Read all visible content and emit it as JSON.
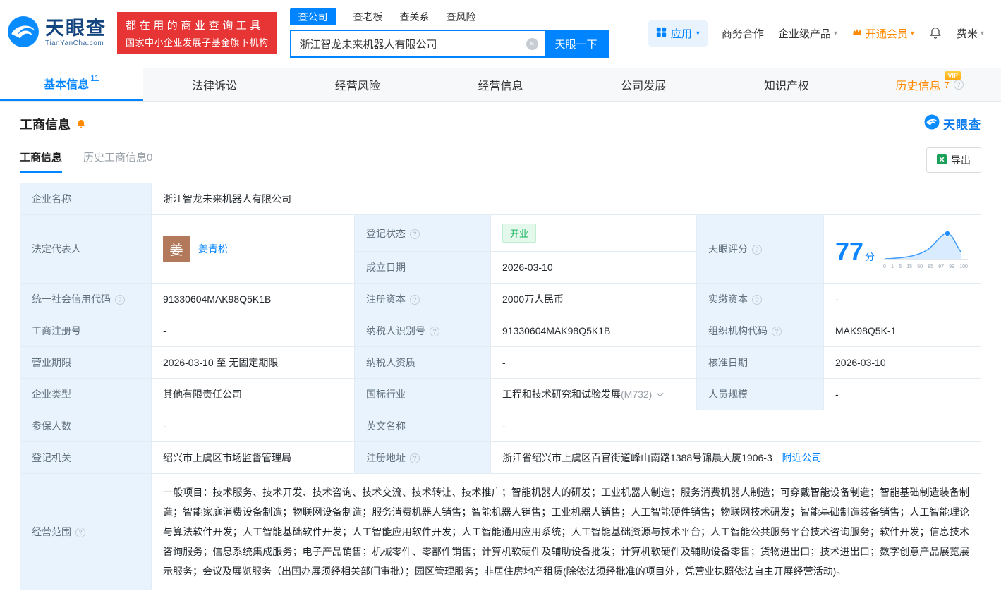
{
  "icons": {
    "help": "?",
    "caret": "▾",
    "close": "×"
  },
  "brand": {
    "logo_title": "天眼查",
    "logo_subtitle": "TianYanCha.com",
    "promo_line1": "都在用的商业查询工具",
    "promo_line2": "国家中小企业发展子基金旗下机构"
  },
  "search": {
    "tabs": [
      {
        "label": "查公司"
      },
      {
        "label": "查老板"
      },
      {
        "label": "查关系"
      },
      {
        "label": "查风险"
      }
    ],
    "value": "浙江智龙未来机器人有限公司",
    "button": "天眼一下"
  },
  "top_menu": {
    "apps": "应用",
    "cooperation": "商务合作",
    "enterprise": "企业级产品",
    "vip": "开通会员",
    "user": "费米"
  },
  "nav_tabs": [
    {
      "label": "基本信息",
      "count": "11"
    },
    {
      "label": "法律诉讼"
    },
    {
      "label": "经营风险"
    },
    {
      "label": "经营信息"
    },
    {
      "label": "公司发展"
    },
    {
      "label": "知识产权"
    },
    {
      "label": "历史信息",
      "count": "7",
      "vip": "VIP"
    }
  ],
  "section": {
    "title": "工商信息",
    "subtab_active": "工商信息",
    "subtab_history": "历史工商信息0",
    "export_label": "导出",
    "mini_logo": "天眼查"
  },
  "biz": {
    "company_name_label": "企业名称",
    "company_name": "浙江智龙未来机器人有限公司",
    "legal_rep_label": "法定代表人",
    "legal_rep_avatar": "姜",
    "legal_rep_name": "姜青松",
    "reg_status_label": "登记状态",
    "reg_status": "开业",
    "score_label": "天眼评分",
    "score": "77",
    "score_unit": "分",
    "established_label": "成立日期",
    "established": "2026-03-10",
    "credit_code_label": "统一社会信用代码",
    "credit_code": "91330604MAK98Q5K1B",
    "reg_capital_label": "注册资本",
    "reg_capital": "2000万人民币",
    "paid_capital_label": "实缴资本",
    "paid_capital": "-",
    "reg_number_label": "工商注册号",
    "reg_number": "-",
    "taxpayer_id_label": "纳税人识别号",
    "taxpayer_id": "91330604MAK98Q5K1B",
    "org_code_label": "组织机构代码",
    "org_code": "MAK98Q5K-1",
    "business_term_label": "营业期限",
    "business_term": "2026-03-10 至 无固定期限",
    "taxpayer_quality_label": "纳税人资质",
    "taxpayer_quality": "-",
    "approval_date_label": "核准日期",
    "approval_date": "2026-03-10",
    "company_type_label": "企业类型",
    "company_type": "其他有限责任公司",
    "industry_label": "国标行业",
    "industry": "工程和技术研究和试验发展",
    "industry_code": "(M732)",
    "staff_size_label": "人员规模",
    "staff_size": "-",
    "insured_label": "参保人数",
    "insured": "-",
    "english_name_label": "英文名称",
    "english_name": "-",
    "registry_label": "登记机关",
    "registry": "绍兴市上虞区市场监督管理局",
    "address_label": "注册地址",
    "address": "浙江省绍兴市上虞区百官街道峰山南路1388号锦晨大厦1906-3",
    "nearby_link": "附近公司",
    "scope_label": "经营范围",
    "scope": "一般项目：技术服务、技术开发、技术咨询、技术交流、技术转让、技术推广；智能机器人的研发；工业机器人制造；服务消费机器人制造；可穿戴智能设备制造；智能基础制造装备制造；智能家庭消费设备制造；物联网设备制造；服务消费机器人销售；智能机器人销售；工业机器人销售；人工智能硬件销售；物联网技术研发；智能基础制造装备销售；人工智能理论与算法软件开发；人工智能基础软件开发；人工智能应用软件开发；人工智能通用应用系统；人工智能基础资源与技术平台；人工智能公共服务平台技术咨询服务；软件开发；信息技术咨询服务；信息系统集成服务；电子产品销售；机械零件、零部件销售；计算机软硬件及辅助设备批发；计算机软硬件及辅助设备零售；货物进出口；技术进出口；数字创意产品展览展示服务；会议及展览服务（出国办展须经相关部门审批）；园区管理服务；非居住房地产租赁(除依法须经批准的项目外，凭营业执照依法自主开展经营活动)。"
  },
  "score_chart": {
    "axis": [
      "0",
      "1",
      "5",
      "15",
      "50",
      "85",
      "97",
      "99",
      "100"
    ]
  },
  "colors": {
    "accent_blue": "#0084ff",
    "promo_red": "#e73435",
    "status_green": "#0bb157",
    "vip_orange": "#ff8a00",
    "label_bg": "#e8f3fd"
  }
}
